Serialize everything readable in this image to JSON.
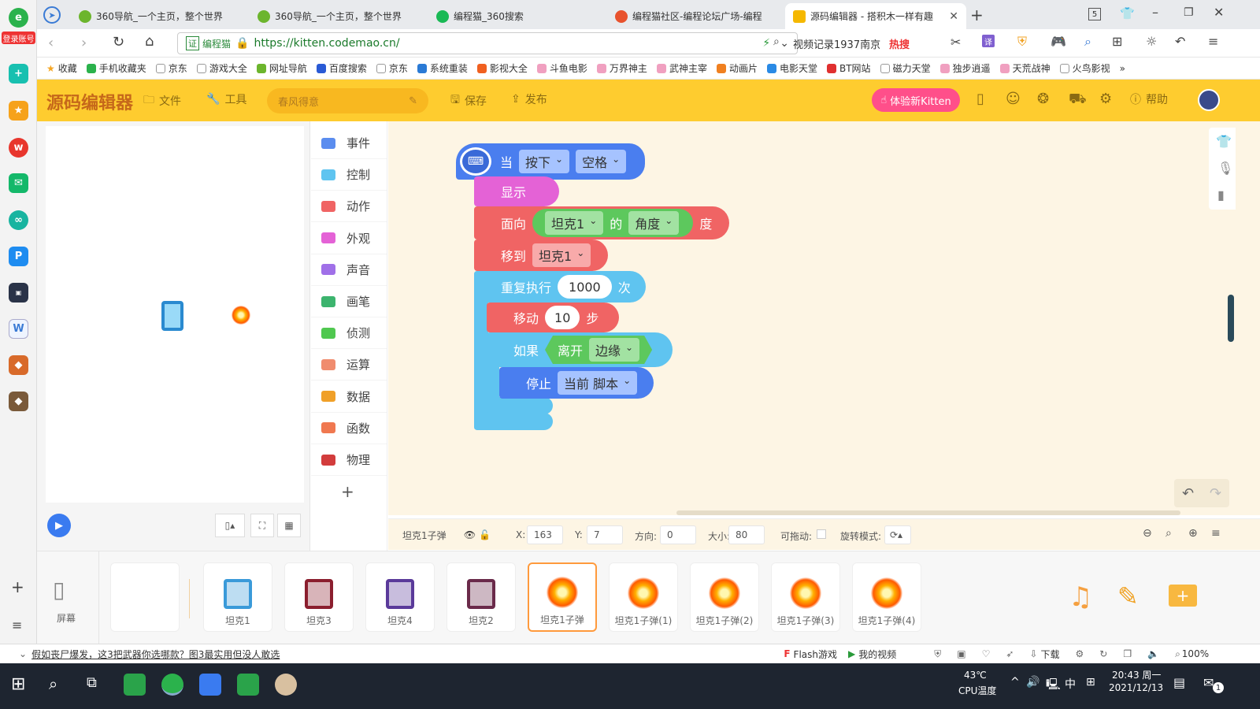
{
  "browser": {
    "login_label": "登录账号",
    "tabs": [
      {
        "title": "360导航_一个主页，整个世界"
      },
      {
        "title": "360导航_一个主页，整个世界"
      },
      {
        "title": "编程猫_360搜索"
      },
      {
        "title": "编程猫社区-编程论坛广场-编程"
      },
      {
        "title": "源码编辑器 - 搭积木一样有趣"
      }
    ],
    "tab_count": "5",
    "security_label": "证",
    "site_label": "编程猫",
    "url": "https://kitten.codemao.cn/",
    "search_text": "视频记录1937南京",
    "hot_label": "热搜",
    "bookmarks": [
      "收藏",
      "手机收藏夹",
      "京东",
      "游戏大全",
      "网址导航",
      "百度搜索",
      "京东",
      "系统重装",
      "影视大全",
      "斗鱼电影",
      "万界神主",
      "武神主宰",
      "动画片",
      "电影天堂",
      "BT网站",
      "磁力天堂",
      "独步逍遥",
      "天荒战神",
      "火鸟影视"
    ],
    "more_label": "»"
  },
  "app": {
    "logo": "源码编辑器",
    "file_label": "文件",
    "tools_label": "工具",
    "project_name": "春风得意",
    "save_label": "保存",
    "publish_label": "发布",
    "try_label": "体验新Kitten",
    "help_label": "帮助"
  },
  "categories": [
    {
      "label": "事件",
      "color": "#5b8def"
    },
    {
      "label": "控制",
      "color": "#5fc4f0"
    },
    {
      "label": "动作",
      "color": "#f06464"
    },
    {
      "label": "外观",
      "color": "#e462d6"
    },
    {
      "label": "声音",
      "color": "#a070e8"
    },
    {
      "label": "画笔",
      "color": "#3cb46e"
    },
    {
      "label": "侦测",
      "color": "#50c850"
    },
    {
      "label": "运算",
      "color": "#f08c6e"
    },
    {
      "label": "数据",
      "color": "#f0a028"
    },
    {
      "label": "函数",
      "color": "#f07850"
    },
    {
      "label": "物理",
      "color": "#d23c3c"
    }
  ],
  "add_label": "+",
  "script": {
    "when": "当",
    "press": "按下",
    "key": "空格",
    "show": "显示",
    "face": "面向",
    "face_target": "坦克1",
    "of": "的",
    "attr": "角度",
    "deg": "度",
    "moveto": "移到",
    "moveto_target": "坦克1",
    "repeat": "重复执行",
    "repeat_count": "1000",
    "times": "次",
    "move": "移动",
    "steps": "10",
    "step_unit": "步",
    "if": "如果",
    "touch": "离开",
    "edge": "边缘",
    "stop": "停止",
    "stop_target": "当前 脚本"
  },
  "props": {
    "sprite_name": "坦克1子弹",
    "x_label": "X:",
    "x": "163",
    "y_label": "Y:",
    "y": "7",
    "dir_label": "方向:",
    "dir": "0",
    "size_label": "大小:",
    "size": "80",
    "drag_label": "可拖动:",
    "rotate_label": "旋转模式:"
  },
  "screen_label": "屏幕",
  "sprites": [
    {
      "name": "坦克1",
      "kind": "tank",
      "color": "#3a9ad9"
    },
    {
      "name": "坦克3",
      "kind": "tank",
      "color": "#8b1e2e"
    },
    {
      "name": "坦克4",
      "kind": "tank",
      "color": "#5a3a9a"
    },
    {
      "name": "坦克2",
      "kind": "tank",
      "color": "#6a2a4a"
    },
    {
      "name": "坦克1子弹",
      "kind": "ball",
      "selected": true
    },
    {
      "name": "坦克1子弹(1)",
      "kind": "ball"
    },
    {
      "name": "坦克1子弹(2)",
      "kind": "ball"
    },
    {
      "name": "坦克1子弹(3)",
      "kind": "ball"
    },
    {
      "name": "坦克1子弹(4)",
      "kind": "ball"
    }
  ],
  "statusbar": {
    "news": "假如丧尸爆发，这3把武器你选哪款？图3最实用但没人敢选",
    "flash": "Flash游戏",
    "video": "我的视频",
    "download": "下载",
    "zoom": "100%"
  },
  "taskbar": {
    "temp": "43℃",
    "temp_label": "CPU温度",
    "ime": "中",
    "time": "20:43 周一",
    "date": "2021/12/13",
    "notif": "1"
  }
}
